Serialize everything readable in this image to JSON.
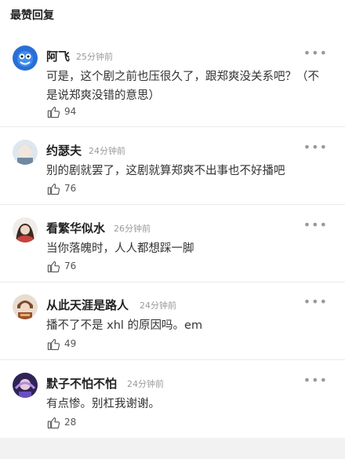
{
  "section": {
    "title": "最赞回复"
  },
  "comments": [
    {
      "name": "阿飞",
      "time": "25分钟前",
      "text": "可是，这个剧之前也压很久了，跟郑爽没关系吧？（不是说郑爽没错的意思）",
      "likes": "94",
      "avatar_color": "#2a6fd6"
    },
    {
      "name": "约瑟夫",
      "time": "24分钟前",
      "text": "别的剧就罢了，这剧就算郑爽不出事也不好播吧",
      "likes": "76",
      "avatar_color": "#8fb0c8"
    },
    {
      "name": "看繁华似水",
      "time": "26分钟前",
      "text": "当你落魄时，人人都想踩一脚",
      "likes": "76",
      "avatar_color": "#c9423c"
    },
    {
      "name": "从此天涯是路人",
      "time": "24分钟前",
      "text": "播不了不是 xhl 的原因吗。em",
      "likes": "49",
      "avatar_color": "#7a4a2e"
    },
    {
      "name": "默子不怕不怕",
      "time": "24分钟前",
      "text": "有点惨。别杠我谢谢。",
      "likes": "28",
      "avatar_color": "#4b3a8c"
    }
  ],
  "icons": {
    "like": "thumbs-up-icon",
    "more": "more-dots-icon"
  }
}
